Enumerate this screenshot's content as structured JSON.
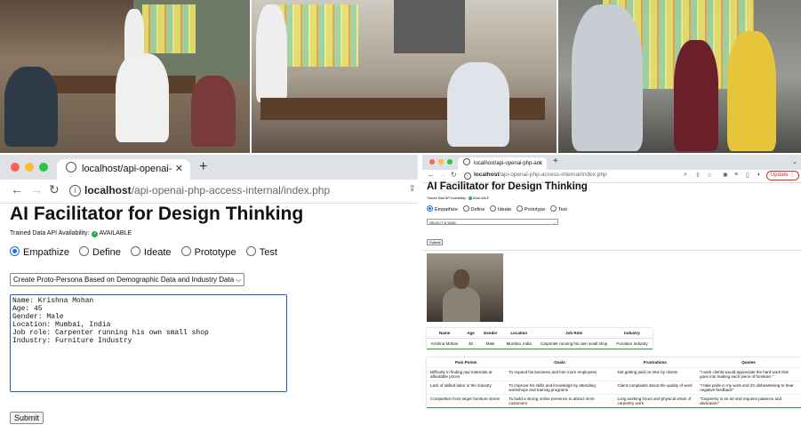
{
  "left_browser": {
    "tab_title": "localhost/api-openai-php-acce",
    "url_host": "localhost",
    "url_path": "/api-openai-php-access-internal/index.php",
    "page_title": "AI Facilitator for Design Thinking",
    "availability_label": "Trained Data API Availability:",
    "availability_status": "AVAILABLE",
    "radio_options": [
      "Empathize",
      "Define",
      "Ideate",
      "Prototype",
      "Test"
    ],
    "selected_radio": "Empathize",
    "task_select_value": "Create Proto-Persona Based on Demographic Data and Industry Data",
    "textarea_value": "Name: Krishna Mohan\nAge: 45\nGender: Male\nLocation: Mumbai, India\nJob role: Carpenter running his own small shop\nIndustry: Furniture Industry",
    "submit_label": "Submit"
  },
  "right_browser": {
    "tab_title": "localhost/api-openai-php-acc",
    "url_host": "localhost",
    "url_path": "/api-openai-php-access-internal/index.php",
    "update_label": "Update",
    "page_title": "AI Facilitator for Design Thinking",
    "availability_label": "Trained Data API Availability:",
    "availability_status": "AVAILABLE",
    "radio_options": [
      "Empathize",
      "Define",
      "Ideate",
      "Prototype",
      "Test"
    ],
    "selected_radio": "Empathize",
    "task_select_value": "SELECT A TASK",
    "submit_label": "Submit",
    "persona_table": {
      "headers": [
        "Name",
        "Age",
        "Gender",
        "Location",
        "Job Role",
        "Industry"
      ],
      "row": [
        "Krishna Mohan",
        "45",
        "Male",
        "Mumbai, India",
        "Carpenter running his own small shop",
        "Furniture Industry"
      ]
    },
    "detail_table": {
      "headers": [
        "Pain Points",
        "Goals",
        "Frustrations",
        "Quotes"
      ],
      "rows": [
        [
          "Difficulty in finding raw materials at affordable prices",
          "To expand his business and hire more employees",
          "Not getting paid on time by clients",
          "\"I wish clients would appreciate the hard work that goes into making each piece of furniture.\""
        ],
        [
          "Lack of skilled labor in the industry",
          "To improve his skills and knowledge by attending workshops and training programs",
          "Client complaints about the quality of work",
          "\"I take pride in my work and it's disheartening to hear negative feedback\""
        ],
        [
          "Competition from larger furniture stores",
          "To build a strong online presence to attract more customers",
          "Long working hours and physical strain of carpentry work",
          "\"Carpentry is an art and requires patience and dedication\""
        ]
      ]
    }
  },
  "colors": {
    "tabbar": "#dee1e6",
    "radio_selected": "#1a73e8",
    "available_green": "#2ea44f",
    "update_red": "#d93025"
  }
}
